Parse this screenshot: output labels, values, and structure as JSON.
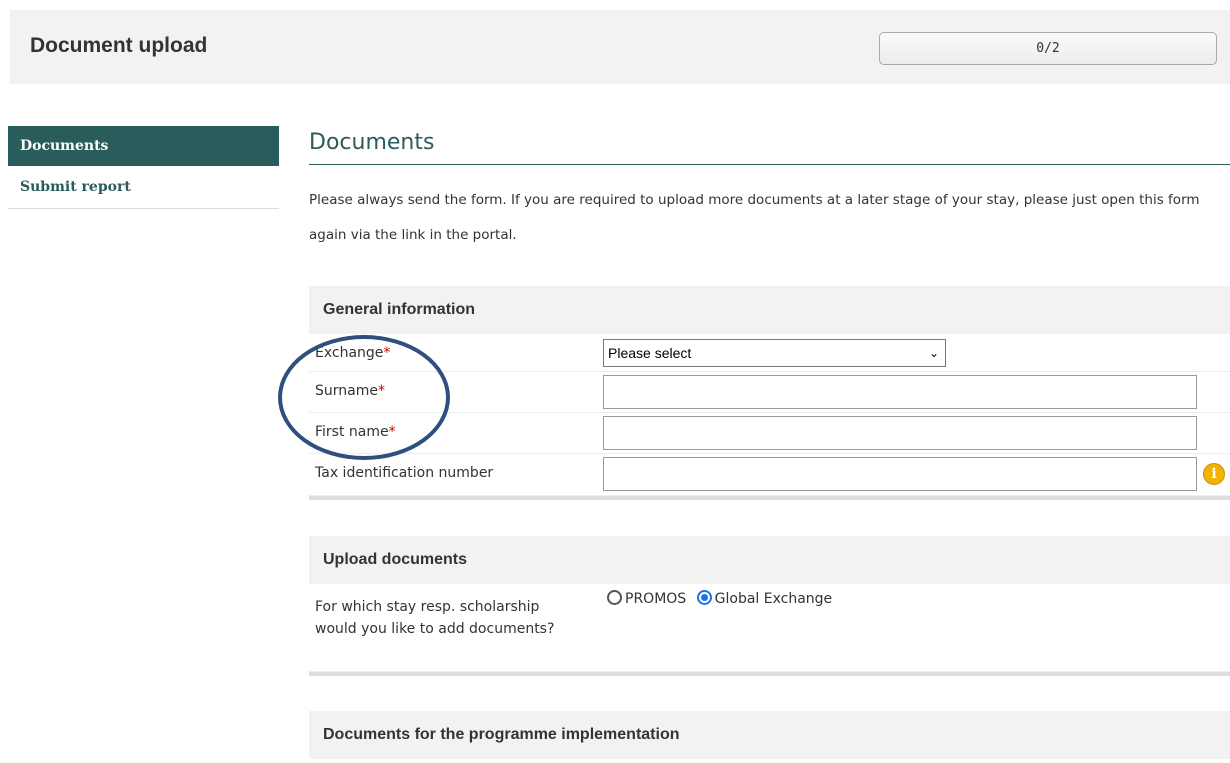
{
  "header": {
    "title": "Document upload",
    "progress": "0/2"
  },
  "sidebar": {
    "items": [
      {
        "label": "Documents"
      },
      {
        "label": "Submit report"
      }
    ]
  },
  "main": {
    "title": "Documents",
    "intro": "Please always send the form. If you are required to upload more documents at a later stage of your stay, please just open this form again via the link in the portal."
  },
  "general": {
    "heading": "General information",
    "exchange_label": "Exchange",
    "exchange_value": "Please select",
    "surname_label": "Surname",
    "surname_value": "",
    "firstname_label": "First name",
    "firstname_value": "",
    "tax_label": "Tax identification number",
    "tax_value": "",
    "required_mark": "*"
  },
  "upload": {
    "heading": "Upload documents",
    "question": "For which stay resp. scholarship would you like to add documents?",
    "options": [
      {
        "label": "PROMOS",
        "checked": false
      },
      {
        "label": "Global Exchange",
        "checked": true
      }
    ]
  },
  "implementation": {
    "heading": "Documents for the programme implementation"
  },
  "icons": {
    "info": "info-icon",
    "dropdown": "chevron-down-icon"
  },
  "colors": {
    "accent": "#2b5c5c",
    "required": "#cc0000",
    "info": "#f0b400",
    "annotation": "#2f4f7f"
  }
}
